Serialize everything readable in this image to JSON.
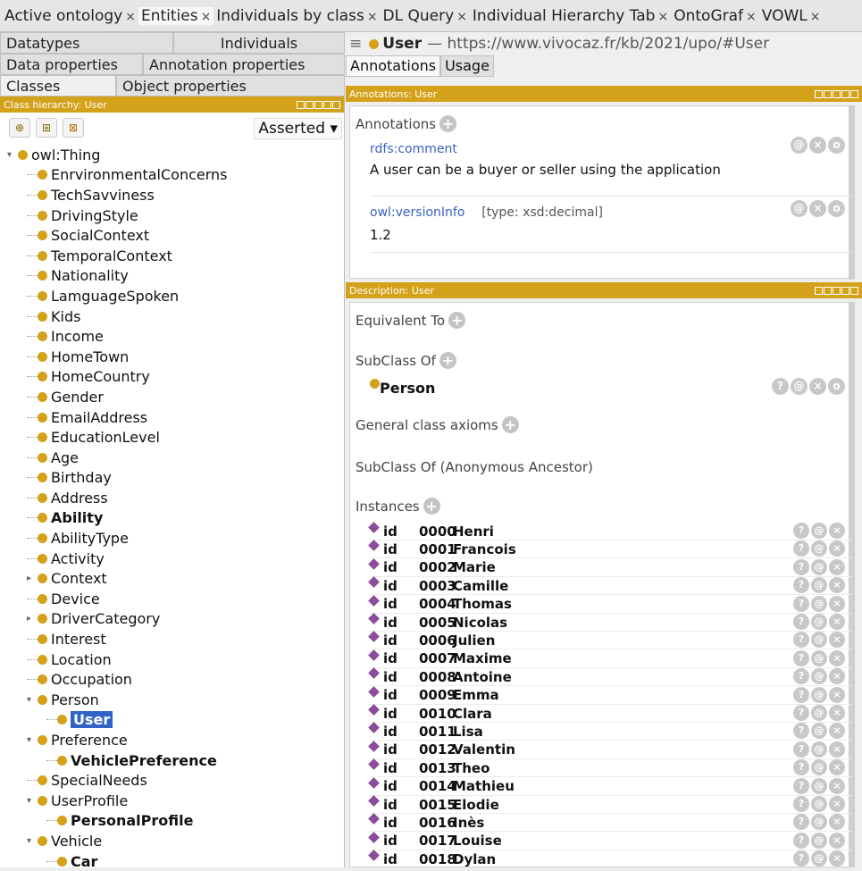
{
  "top_tabs": [
    {
      "label": "Active ontology"
    },
    {
      "label": "Entities"
    },
    {
      "label": "Individuals by class"
    },
    {
      "label": "DL Query"
    },
    {
      "label": "Individual Hierarchy Tab"
    },
    {
      "label": "OntoGraf"
    },
    {
      "label": "VOWL"
    }
  ],
  "close_glyph": "×",
  "left": {
    "subtabs_row1": [
      "Datatypes",
      "Individuals"
    ],
    "subtabs_row2": [
      "Data properties",
      "Annotation properties"
    ],
    "subtabs_row3": [
      "Classes",
      "Object properties"
    ],
    "view_title": "Class hierarchy: User",
    "asserted": "Asserted ▾",
    "tree": [
      {
        "label": "owl:Thing",
        "level": 0,
        "expanded": true,
        "bold": false
      },
      {
        "label": "EnrvironmentalConcerns",
        "level": 1,
        "bold": false
      },
      {
        "label": "TechSavviness",
        "level": 1,
        "bold": false
      },
      {
        "label": "DrivingStyle",
        "level": 1,
        "bold": false
      },
      {
        "label": "SocialContext",
        "level": 1,
        "bold": false
      },
      {
        "label": "TemporalContext",
        "level": 1,
        "bold": false
      },
      {
        "label": "Nationality",
        "level": 1,
        "bold": false
      },
      {
        "label": "LamguageSpoken",
        "level": 1,
        "bold": false
      },
      {
        "label": "Kids",
        "level": 1,
        "bold": false
      },
      {
        "label": "Income",
        "level": 1,
        "bold": false
      },
      {
        "label": "HomeTown",
        "level": 1,
        "bold": false
      },
      {
        "label": "HomeCountry",
        "level": 1,
        "bold": false
      },
      {
        "label": "Gender",
        "level": 1,
        "bold": false
      },
      {
        "label": "EmailAddress",
        "level": 1,
        "bold": false
      },
      {
        "label": "EducationLevel",
        "level": 1,
        "bold": false
      },
      {
        "label": "Age",
        "level": 1,
        "bold": false
      },
      {
        "label": "Birthday",
        "level": 1,
        "bold": false
      },
      {
        "label": "Address",
        "level": 1,
        "bold": false
      },
      {
        "label": "Ability",
        "level": 1,
        "bold": true
      },
      {
        "label": "AbilityType",
        "level": 1,
        "bold": false
      },
      {
        "label": "Activity",
        "level": 1,
        "bold": false
      },
      {
        "label": "Context",
        "level": 1,
        "collapsed": true,
        "bold": false
      },
      {
        "label": "Device",
        "level": 1,
        "bold": false
      },
      {
        "label": "DriverCategory",
        "level": 1,
        "collapsed": true,
        "bold": false
      },
      {
        "label": "Interest",
        "level": 1,
        "bold": false
      },
      {
        "label": "Location",
        "level": 1,
        "bold": false
      },
      {
        "label": "Occupation",
        "level": 1,
        "bold": false
      },
      {
        "label": "Person",
        "level": 1,
        "expanded": true,
        "bold": false
      },
      {
        "label": "User",
        "level": 2,
        "bold": true,
        "selected": true
      },
      {
        "label": "Preference",
        "level": 1,
        "expanded": true,
        "bold": false
      },
      {
        "label": "VehiclePreference",
        "level": 2,
        "bold": true
      },
      {
        "label": "SpecialNeeds",
        "level": 1,
        "bold": false
      },
      {
        "label": "UserProfile",
        "level": 1,
        "expanded": true,
        "bold": false
      },
      {
        "label": "PersonalProfile",
        "level": 2,
        "bold": true
      },
      {
        "label": "Vehicle",
        "level": 1,
        "expanded": true,
        "bold": false
      },
      {
        "label": "Car",
        "level": 2,
        "bold": true
      }
    ]
  },
  "right": {
    "entity_name": "User",
    "entity_iri": "— https://www.vivocaz.fr/kb/2021/upo/#User",
    "tabs": [
      "Annotations",
      "Usage"
    ],
    "annotations_view_title": "Annotations: User",
    "annotations_header": "Annotations",
    "annotations": [
      {
        "property": "rdfs:comment",
        "type": "",
        "value": "A user can be a buyer or seller using the application"
      },
      {
        "property": "owl:versionInfo",
        "type": "[type: xsd:decimal]",
        "value": "1.2"
      }
    ],
    "description_view_title": "Description: User",
    "equivalent_to": "Equivalent To",
    "subclass_of": "SubClass Of",
    "subclass_of_value": "Person",
    "general_class_axioms": "General class axioms",
    "subclass_anon": "SubClass Of (Anonymous Ancestor)",
    "instances_header": "Instances",
    "instances": [
      {
        "id": "id",
        "num": "0000",
        "name": "Henri"
      },
      {
        "id": "id",
        "num": "0001",
        "name": "Francois"
      },
      {
        "id": "id",
        "num": "0002",
        "name": "Marie"
      },
      {
        "id": "id",
        "num": "0003",
        "name": "Camille"
      },
      {
        "id": "id",
        "num": "0004",
        "name": "Thomas"
      },
      {
        "id": "id",
        "num": "0005",
        "name": "Nicolas"
      },
      {
        "id": "id",
        "num": "0006",
        "name": "Julien"
      },
      {
        "id": "id",
        "num": "0007",
        "name": "Maxime"
      },
      {
        "id": "id",
        "num": "0008",
        "name": "Antoine"
      },
      {
        "id": "id",
        "num": "0009",
        "name": "Emma"
      },
      {
        "id": "id",
        "num": "0010",
        "name": "Clara"
      },
      {
        "id": "id",
        "num": "0011",
        "name": "Lisa"
      },
      {
        "id": "id",
        "num": "0012",
        "name": "Valentin"
      },
      {
        "id": "id",
        "num": "0013",
        "name": "Theo"
      },
      {
        "id": "id",
        "num": "0014",
        "name": "Mathieu"
      },
      {
        "id": "id",
        "num": "0015",
        "name": "Elodie"
      },
      {
        "id": "id",
        "num": "0016",
        "name": "Inès"
      },
      {
        "id": "id",
        "num": "0017",
        "name": "Louise"
      },
      {
        "id": "id",
        "num": "0018",
        "name": "Dylan"
      }
    ],
    "btn_glyphs": {
      "help": "?",
      "at": "@",
      "x": "×",
      "o": "o"
    }
  },
  "colors": {
    "accent": "#d4a21a",
    "selection": "#2f63c6",
    "individual": "#8b4c9a",
    "link": "#3a62c0"
  }
}
